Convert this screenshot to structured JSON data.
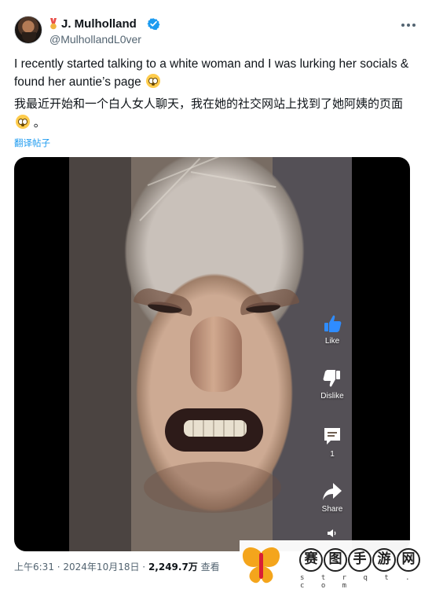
{
  "tweet": {
    "author": {
      "display_name": "J. Mulholland",
      "handle": "@MulhollandL0ver",
      "verified": true
    },
    "text": {
      "english": "I recently started talking to a white woman and I was lurking her socials & found her auntie’s page",
      "chinese": "我最近开始和一个白人女人聊天，我在她的社交网站上找到了她阿姨的页面"
    },
    "emoji": "flushed-face",
    "translate_label": "翻译帖子",
    "timestamp": "上午6:31 · 2024年10月18日",
    "views_count": "2,249.7万",
    "views_label": " 查看",
    "footer_separator": " · "
  },
  "video_overlay": {
    "like_label": "Like",
    "dislike_label": "Dislike",
    "comment_count": "1",
    "share_label": "Share"
  },
  "watermark": {
    "characters": [
      "赛",
      "图",
      "手",
      "游",
      "网"
    ],
    "domain": "s t r q t . c o m"
  },
  "colors": {
    "primary_text": "#0f1419",
    "secondary_text": "#536471",
    "link": "#1d9bf0",
    "verified": "#1d9bf0"
  },
  "icons": {
    "more": "more-horizontal-icon",
    "verified": "verified-check-icon",
    "medal": "medal-icon",
    "like": "thumbs-up-icon",
    "dislike": "thumbs-down-icon",
    "comment": "comment-icon",
    "share": "share-arrow-icon",
    "volume": "volume-icon"
  }
}
